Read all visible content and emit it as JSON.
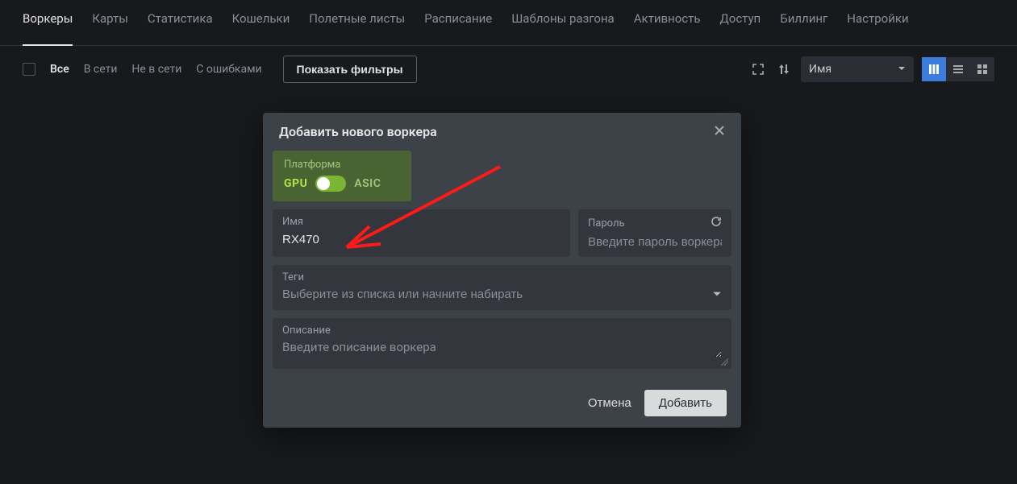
{
  "nav": {
    "items": [
      "Воркеры",
      "Карты",
      "Статистика",
      "Кошельки",
      "Полетные листы",
      "Расписание",
      "Шаблоны разгона",
      "Активность",
      "Доступ",
      "Биллинг",
      "Настройки"
    ],
    "active_index": 0
  },
  "filters": {
    "all": "Все",
    "online": "В сети",
    "offline": "Не в сети",
    "errors": "С ошибками",
    "show_filters": "Показать фильтры"
  },
  "sort": {
    "selected": "Имя"
  },
  "modal": {
    "title": "Добавить нового воркера",
    "platform_label": "Платформа",
    "platform_gpu": "GPU",
    "platform_asic": "ASIC",
    "name_label": "Имя",
    "name_value": "RX470",
    "password_label": "Пароль",
    "password_placeholder": "Введите пароль воркера",
    "tags_label": "Теги",
    "tags_placeholder": "Выберите из списка или начните набирать",
    "desc_label": "Описание",
    "desc_placeholder": "Введите описание воркера",
    "cancel": "Отмена",
    "add": "Добавить"
  }
}
